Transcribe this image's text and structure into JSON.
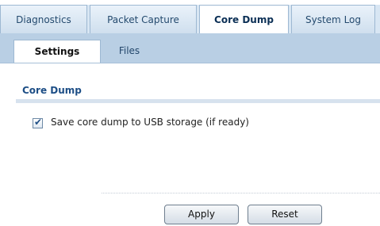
{
  "main_tabs": [
    {
      "label": "Diagnostics",
      "active": false
    },
    {
      "label": "Packet Capture",
      "active": false
    },
    {
      "label": "Core Dump",
      "active": true
    },
    {
      "label": "System Log",
      "active": false
    }
  ],
  "sub_tabs": [
    {
      "label": "Settings",
      "active": true
    },
    {
      "label": "Files",
      "active": false
    }
  ],
  "section": {
    "title": "Core Dump"
  },
  "options": {
    "save_to_usb": {
      "checked": true,
      "label": "Save core dump to USB storage (if ready)"
    }
  },
  "buttons": {
    "apply_label": "Apply",
    "reset_label": "Reset"
  },
  "colors": {
    "tab_bar": "#d8e6f3",
    "sub_bar": "#b9cfe4",
    "section_title": "#1d4e86"
  }
}
